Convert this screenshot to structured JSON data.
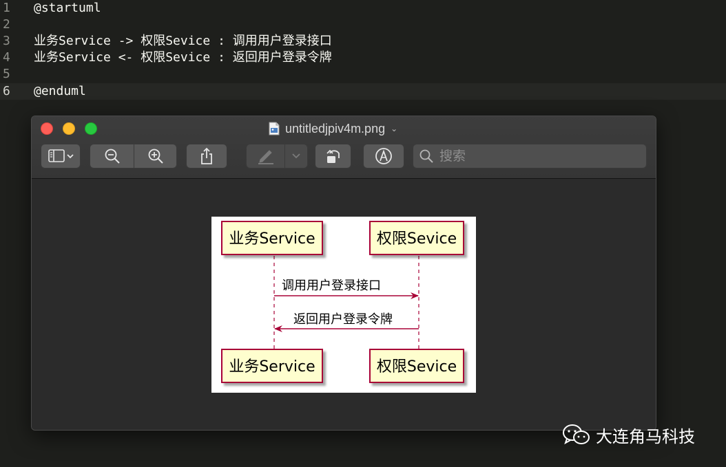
{
  "editor": {
    "lines": [
      {
        "num": "1",
        "text": "@startuml"
      },
      {
        "num": "2",
        "text": ""
      },
      {
        "num": "3",
        "text": "业务Service -> 权限Sevice : 调用用户登录接口"
      },
      {
        "num": "4",
        "text": "业务Service <- 权限Sevice : 返回用户登录令牌"
      },
      {
        "num": "5",
        "text": ""
      },
      {
        "num": "6",
        "text": "@enduml"
      }
    ]
  },
  "window": {
    "title": "untitledjpiv4m.png",
    "search_placeholder": "搜索"
  },
  "diagram": {
    "participants": [
      "业务Service",
      "权限Sevice"
    ],
    "messages": [
      "调用用户登录接口",
      "返回用户登录令牌"
    ],
    "colors": {
      "box_fill": "#fefece",
      "border": "#a80036"
    }
  },
  "watermark": {
    "text": "大连角马科技"
  }
}
